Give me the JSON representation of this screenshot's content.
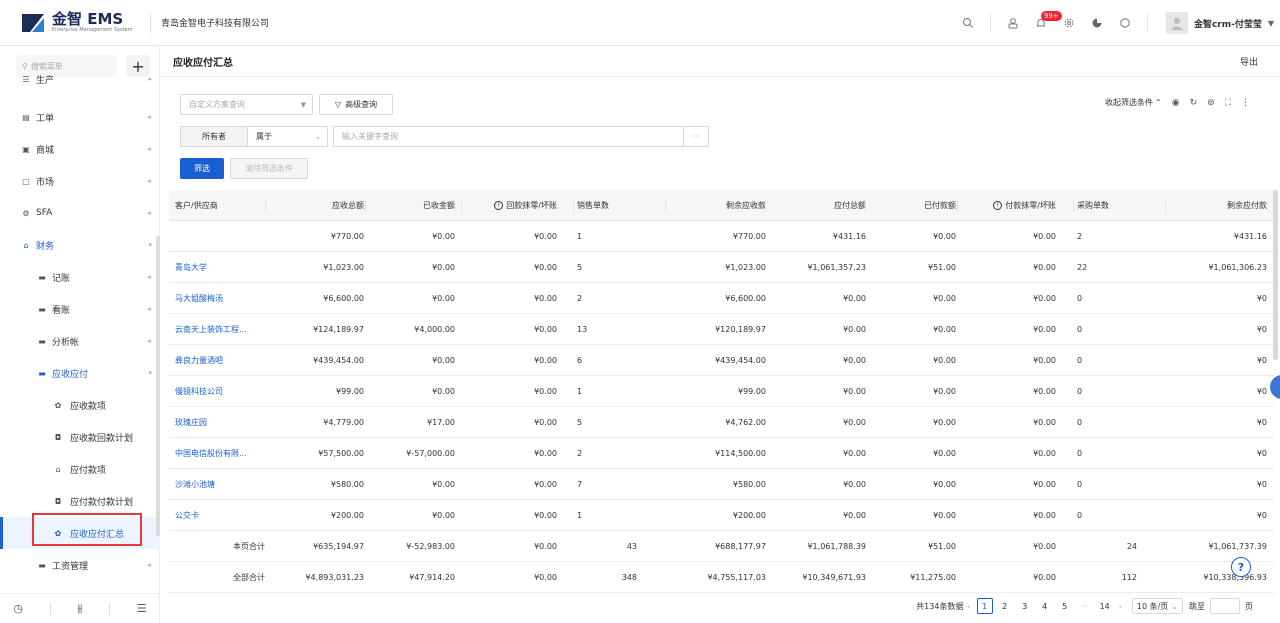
{
  "header": {
    "logo_title": "金智 EMS",
    "logo_sub": "Enterprise Management System",
    "company": "青岛金智电子科技有限公司",
    "badge": "99+",
    "user_name": "金智crm-付莹莹"
  },
  "sidebar": {
    "search_placeholder": "搜索菜单",
    "items": [
      {
        "label": "生产",
        "icon": "production-icon"
      },
      {
        "label": "工单",
        "icon": "workorder-icon"
      },
      {
        "label": "商城",
        "icon": "mall-icon"
      },
      {
        "label": "市场",
        "icon": "market-icon"
      },
      {
        "label": "SFA",
        "icon": "sfa-icon"
      },
      {
        "label": "财务",
        "icon": "finance-icon"
      },
      {
        "label": "记账",
        "icon": "folder-icon"
      },
      {
        "label": "看账",
        "icon": "folder-icon"
      },
      {
        "label": "分析帐",
        "icon": "folder-icon"
      },
      {
        "label": "应收应付",
        "icon": "folder-icon"
      },
      {
        "label": "应收款项",
        "icon": "gear-icon"
      },
      {
        "label": "应收款回款计划",
        "icon": "case-icon"
      },
      {
        "label": "应付款项",
        "icon": "house-icon"
      },
      {
        "label": "应付款付款计划",
        "icon": "case-icon"
      },
      {
        "label": "应收应付汇总",
        "icon": "gear-icon"
      },
      {
        "label": "工资管理",
        "icon": "folder-icon"
      }
    ]
  },
  "main": {
    "title": "应收应付汇总",
    "export_label": "导出",
    "scheme_placeholder": "自定义方案查询",
    "advanced_label": "高级查询",
    "collapse_label": "收起筛选条件",
    "owner_label": "所有者",
    "belong_value": "属于",
    "keyword_placeholder": "输入关键字查询",
    "keyword_more": "···",
    "filter_btn": "筛选",
    "clear_btn": "清除筛选条件"
  },
  "table": {
    "headers": [
      "客户/供应商",
      "应收总额",
      "已收金额",
      "回款抹零/坏账",
      "销售单数",
      "剩余应收款",
      "应付总额",
      "已付款额",
      "付款抹零/坏账",
      "采购单数",
      "剩余应付款"
    ],
    "rows": [
      [
        "",
        "¥770.00",
        "¥0.00",
        "¥0.00",
        "1",
        "¥770.00",
        "¥431.16",
        "¥0.00",
        "¥0.00",
        "2",
        "¥431.16"
      ],
      [
        "青岛大学",
        "¥1,023.00",
        "¥0.00",
        "¥0.00",
        "5",
        "¥1,023.00",
        "¥1,061,357.23",
        "¥51.00",
        "¥0.00",
        "22",
        "¥1,061,306.23"
      ],
      [
        "马大姐酸梅汤",
        "¥6,600.00",
        "¥0.00",
        "¥0.00",
        "2",
        "¥6,600.00",
        "¥0.00",
        "¥0.00",
        "¥0.00",
        "0",
        "¥0"
      ],
      [
        "云南天上装饰工程...",
        "¥124,189.97",
        "¥4,000.00",
        "¥0.00",
        "13",
        "¥120,189.97",
        "¥0.00",
        "¥0.00",
        "¥0.00",
        "0",
        "¥0"
      ],
      [
        "彝良力量酒吧",
        "¥439,454.00",
        "¥0.00",
        "¥0.00",
        "6",
        "¥439,454.00",
        "¥0.00",
        "¥0.00",
        "¥0.00",
        "0",
        "¥0"
      ],
      [
        "慢镜科技公司",
        "¥99.00",
        "¥0.00",
        "¥0.00",
        "1",
        "¥99.00",
        "¥0.00",
        "¥0.00",
        "¥0.00",
        "0",
        "¥0"
      ],
      [
        "玫瑰庄园",
        "¥4,779.00",
        "¥17.00",
        "¥0.00",
        "5",
        "¥4,762.00",
        "¥0.00",
        "¥0.00",
        "¥0.00",
        "0",
        "¥0"
      ],
      [
        "中国电信股份有限...",
        "¥57,500.00",
        "¥-57,000.00",
        "¥0.00",
        "2",
        "¥114,500.00",
        "¥0.00",
        "¥0.00",
        "¥0.00",
        "0",
        "¥0"
      ],
      [
        "沙滩小池塘",
        "¥580.00",
        "¥0.00",
        "¥0.00",
        "7",
        "¥580.00",
        "¥0.00",
        "¥0.00",
        "¥0.00",
        "0",
        "¥0"
      ],
      [
        "公交卡",
        "¥200.00",
        "¥0.00",
        "¥0.00",
        "1",
        "¥200.00",
        "¥0.00",
        "¥0.00",
        "¥0.00",
        "0",
        "¥0"
      ]
    ],
    "page_total": [
      "本页合计",
      "¥635,194.97",
      "¥-52,983.00",
      "¥0.00",
      "43",
      "¥688,177.97",
      "¥1,061,788.39",
      "¥51.00",
      "¥0.00",
      "24",
      "¥1,061,737.39"
    ],
    "all_total": [
      "全部合计",
      "¥4,893,031.23",
      "¥47,914.20",
      "¥0.00",
      "348",
      "¥4,755,117.03",
      "¥10,349,671.93",
      "¥11,275.00",
      "¥0.00",
      "112",
      "¥10,338,396.93"
    ]
  },
  "pager": {
    "total": "共134条数据",
    "pages": [
      "1",
      "2",
      "3",
      "4",
      "5",
      "···",
      "14"
    ],
    "page_size": "10 条/页",
    "jump": "跳至",
    "page_unit": "页"
  }
}
